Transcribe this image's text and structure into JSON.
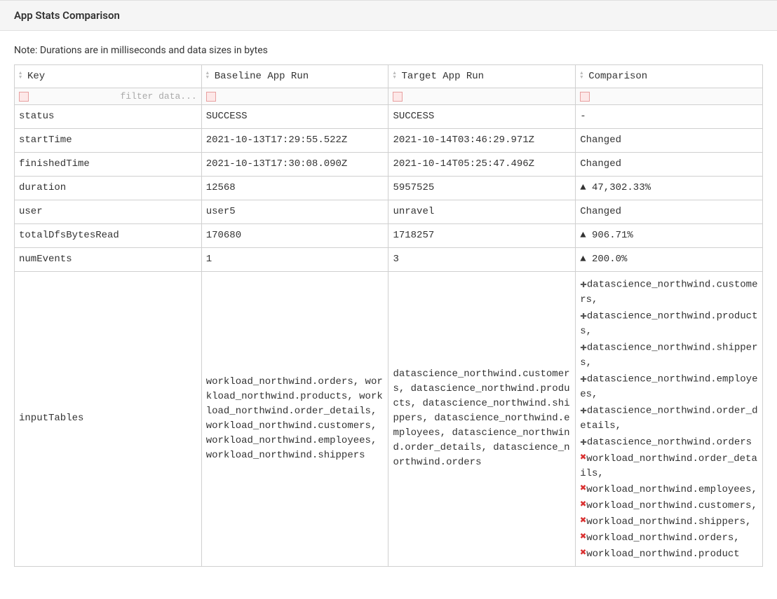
{
  "header": {
    "title": "App Stats Comparison"
  },
  "note": "Note: Durations are in milliseconds and data sizes in bytes",
  "columns": {
    "key": "Key",
    "baseline": "Baseline App Run",
    "target": "Target App Run",
    "comparison": "Comparison"
  },
  "filter": {
    "placeholder": "filter data..."
  },
  "rows": [
    {
      "key": "status",
      "baseline": "SUCCESS",
      "target": "SUCCESS",
      "comparison": "-"
    },
    {
      "key": "startTime",
      "baseline": "2021-10-13T17:29:55.522Z",
      "target": "2021-10-14T03:46:29.971Z",
      "comparison": "Changed"
    },
    {
      "key": "finishedTime",
      "baseline": "2021-10-13T17:30:08.090Z",
      "target": "2021-10-14T05:25:47.496Z",
      "comparison": "Changed"
    },
    {
      "key": "duration",
      "baseline": "12568",
      "target": "5957525",
      "comparison": "▲ 47,302.33%"
    },
    {
      "key": "user",
      "baseline": "user5",
      "target": "unravel",
      "comparison": "Changed"
    },
    {
      "key": "totalDfsBytesRead",
      "baseline": "170680",
      "target": "1718257",
      "comparison": "▲ 906.71%"
    },
    {
      "key": "numEvents",
      "baseline": "1",
      "target": "3",
      "comparison": "▲ 200.0%"
    }
  ],
  "inputTablesRow": {
    "key": "inputTables",
    "baseline": "workload_northwind.orders, workload_northwind.products, workload_northwind.order_details, workload_northwind.customers, workload_northwind.employees, workload_northwind.shippers",
    "target": "datascience_northwind.customers, datascience_northwind.products, datascience_northwind.shippers, datascience_northwind.employees, datascience_northwind.order_details, datascience_northwind.orders",
    "comparison": {
      "added": [
        "datascience_northwind.customers,",
        "datascience_northwind.products,",
        "datascience_northwind.shippers,",
        "datascience_northwind.employees,",
        "datascience_northwind.order_details,",
        "datascience_northwind.orders"
      ],
      "removed": [
        "workload_northwind.order_details,",
        "workload_northwind.employees,",
        "workload_northwind.customers,",
        "workload_northwind.shippers,",
        "workload_northwind.orders,",
        "workload_northwind.product"
      ]
    }
  }
}
